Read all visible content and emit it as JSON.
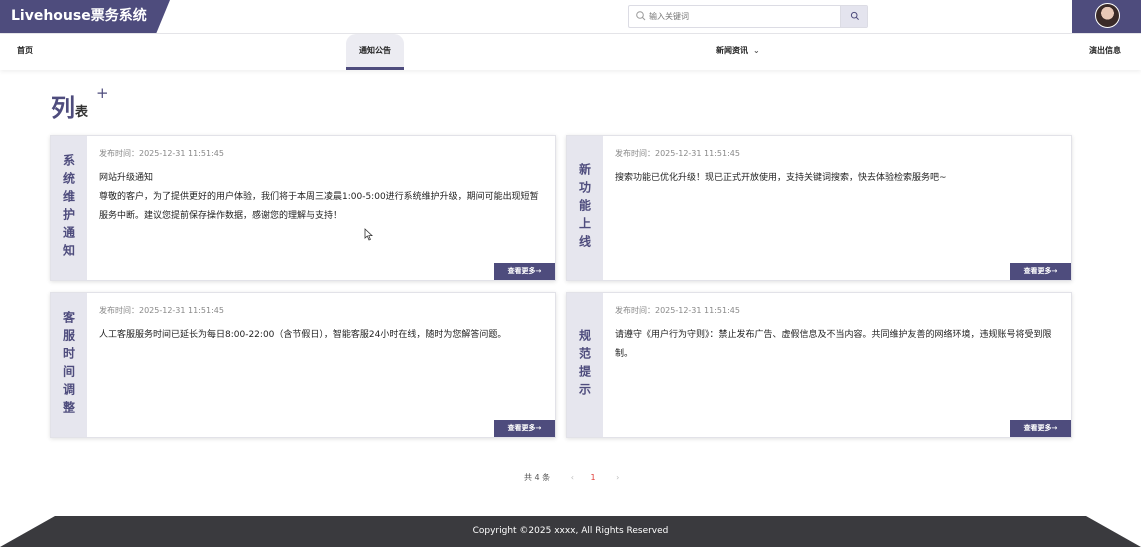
{
  "header": {
    "app_title": "Livehouse票务系统",
    "search_placeholder": "输入关键词"
  },
  "nav": [
    {
      "label": "首页"
    },
    {
      "label": "通知公告"
    },
    {
      "label": "新闻资讯"
    },
    {
      "label": "演出信息"
    }
  ],
  "page_title": {
    "big": "列",
    "small": "表",
    "plus": "+"
  },
  "cards": [
    {
      "side": "系统维护通知",
      "time": "发布时间：2025-12-31 11:51:45",
      "text": "网站升级通知\n尊敬的客户，为了提供更好的用户体验，我们将于本周三凌晨1:00-5:00进行系统维护升级，期间可能出现短暂服务中断。建议您提前保存操作数据，感谢您的理解与支持！",
      "more": "查看更多→"
    },
    {
      "side": "新功能上线",
      "time": "发布时间：2025-12-31 11:51:45",
      "text": "搜索功能已优化升级！现已正式开放使用，支持关键词搜索，快去体验检索服务吧~",
      "more": "查看更多→"
    },
    {
      "side": "客服时间调整",
      "time": "发布时间：2025-12-31 11:51:45",
      "text": "人工客服服务时间已延长为每日8:00-22:00（含节假日），智能客服24小时在线，随时为您解答问题。",
      "more": "查看更多→"
    },
    {
      "side": "规范提示",
      "time": "发布时间：2025-12-31 11:51:45",
      "text": "请遵守《用户行为守则》：禁止发布广告、虚假信息及不当内容。共同维护友善的网络环境，违规账号将受到限制。",
      "more": "查看更多→"
    }
  ],
  "pager": {
    "total": "共 4 条",
    "prev": "‹",
    "page": "1",
    "next": "›"
  },
  "footer": {
    "copyright": "Copyright ©2025 xxxx, All Rights Reserved"
  },
  "colors": {
    "accent": "#4e4c7d",
    "footer": "#3a3a3e",
    "active_page": "#e0403a"
  }
}
